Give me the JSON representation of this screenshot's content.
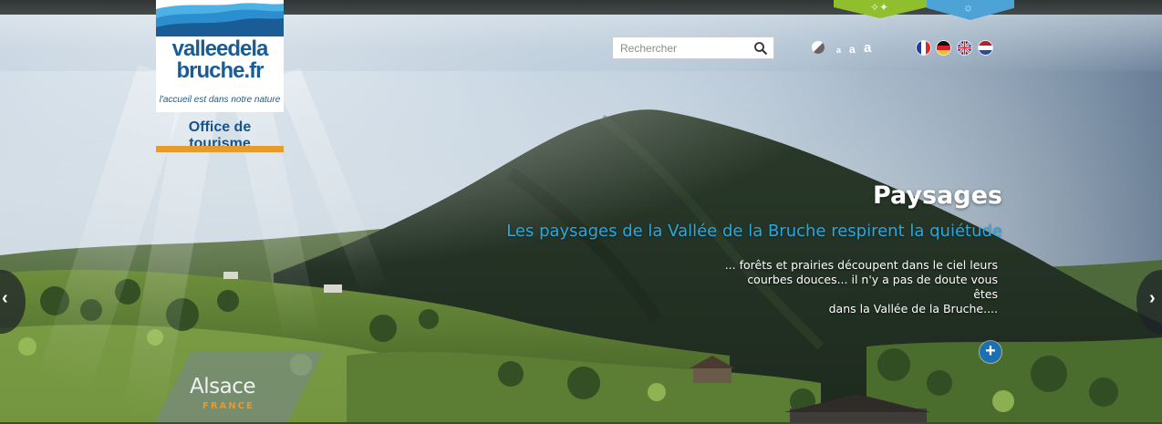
{
  "header": {
    "search": {
      "placeholder": "Rechercher"
    },
    "font_sizes": [
      "a",
      "a",
      "a"
    ],
    "languages": [
      "fr",
      "de",
      "en",
      "nl"
    ]
  },
  "logo": {
    "line1": "valleedela",
    "line2": "bruche.fr",
    "tagline": "l'accueil est dans notre nature",
    "office": "Office de tourisme"
  },
  "slide": {
    "title": "Paysages",
    "subtitle": "Les paysages de la Vallée de la Bruche respirent la quiétude",
    "body_lines": [
      "... forêts et prairies découpent dans le ciel  leurs",
      "courbes douces... il n'y a pas de doute vous êtes",
      "dans la Vallée de la Bruche...."
    ],
    "more_label": "+"
  },
  "navigation": {
    "prev": "‹",
    "next": "›"
  },
  "badge": {
    "name": "Alsace",
    "country": "FRANCE"
  },
  "colors": {
    "brand_blue": "#1a5d96",
    "accent_orange": "#e89a2a",
    "tab_green": "#8fbf2d",
    "tab_blue": "#4da3d6",
    "subtitle_blue": "#27a8e2"
  }
}
